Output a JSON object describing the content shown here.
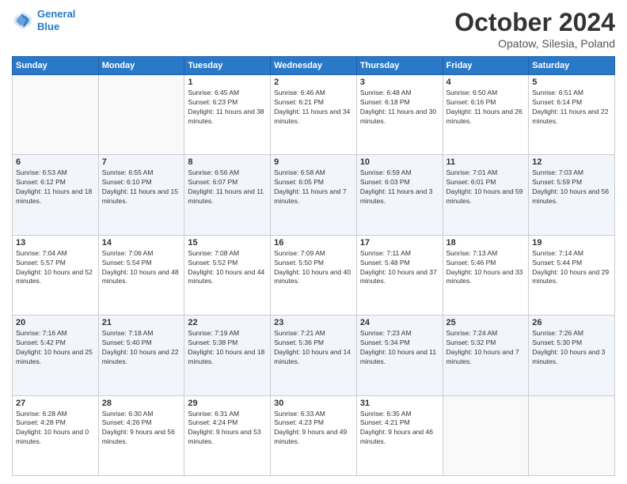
{
  "header": {
    "logo_line1": "General",
    "logo_line2": "Blue",
    "month": "October 2024",
    "location": "Opatow, Silesia, Poland"
  },
  "days_of_week": [
    "Sunday",
    "Monday",
    "Tuesday",
    "Wednesday",
    "Thursday",
    "Friday",
    "Saturday"
  ],
  "weeks": [
    [
      {
        "day": "",
        "sunrise": "",
        "sunset": "",
        "daylight": ""
      },
      {
        "day": "",
        "sunrise": "",
        "sunset": "",
        "daylight": ""
      },
      {
        "day": "1",
        "sunrise": "Sunrise: 6:45 AM",
        "sunset": "Sunset: 6:23 PM",
        "daylight": "Daylight: 11 hours and 38 minutes."
      },
      {
        "day": "2",
        "sunrise": "Sunrise: 6:46 AM",
        "sunset": "Sunset: 6:21 PM",
        "daylight": "Daylight: 11 hours and 34 minutes."
      },
      {
        "day": "3",
        "sunrise": "Sunrise: 6:48 AM",
        "sunset": "Sunset: 6:18 PM",
        "daylight": "Daylight: 11 hours and 30 minutes."
      },
      {
        "day": "4",
        "sunrise": "Sunrise: 6:50 AM",
        "sunset": "Sunset: 6:16 PM",
        "daylight": "Daylight: 11 hours and 26 minutes."
      },
      {
        "day": "5",
        "sunrise": "Sunrise: 6:51 AM",
        "sunset": "Sunset: 6:14 PM",
        "daylight": "Daylight: 11 hours and 22 minutes."
      }
    ],
    [
      {
        "day": "6",
        "sunrise": "Sunrise: 6:53 AM",
        "sunset": "Sunset: 6:12 PM",
        "daylight": "Daylight: 11 hours and 18 minutes."
      },
      {
        "day": "7",
        "sunrise": "Sunrise: 6:55 AM",
        "sunset": "Sunset: 6:10 PM",
        "daylight": "Daylight: 11 hours and 15 minutes."
      },
      {
        "day": "8",
        "sunrise": "Sunrise: 6:56 AM",
        "sunset": "Sunset: 6:07 PM",
        "daylight": "Daylight: 11 hours and 11 minutes."
      },
      {
        "day": "9",
        "sunrise": "Sunrise: 6:58 AM",
        "sunset": "Sunset: 6:05 PM",
        "daylight": "Daylight: 11 hours and 7 minutes."
      },
      {
        "day": "10",
        "sunrise": "Sunrise: 6:59 AM",
        "sunset": "Sunset: 6:03 PM",
        "daylight": "Daylight: 11 hours and 3 minutes."
      },
      {
        "day": "11",
        "sunrise": "Sunrise: 7:01 AM",
        "sunset": "Sunset: 6:01 PM",
        "daylight": "Daylight: 10 hours and 59 minutes."
      },
      {
        "day": "12",
        "sunrise": "Sunrise: 7:03 AM",
        "sunset": "Sunset: 5:59 PM",
        "daylight": "Daylight: 10 hours and 56 minutes."
      }
    ],
    [
      {
        "day": "13",
        "sunrise": "Sunrise: 7:04 AM",
        "sunset": "Sunset: 5:57 PM",
        "daylight": "Daylight: 10 hours and 52 minutes."
      },
      {
        "day": "14",
        "sunrise": "Sunrise: 7:06 AM",
        "sunset": "Sunset: 5:54 PM",
        "daylight": "Daylight: 10 hours and 48 minutes."
      },
      {
        "day": "15",
        "sunrise": "Sunrise: 7:08 AM",
        "sunset": "Sunset: 5:52 PM",
        "daylight": "Daylight: 10 hours and 44 minutes."
      },
      {
        "day": "16",
        "sunrise": "Sunrise: 7:09 AM",
        "sunset": "Sunset: 5:50 PM",
        "daylight": "Daylight: 10 hours and 40 minutes."
      },
      {
        "day": "17",
        "sunrise": "Sunrise: 7:11 AM",
        "sunset": "Sunset: 5:48 PM",
        "daylight": "Daylight: 10 hours and 37 minutes."
      },
      {
        "day": "18",
        "sunrise": "Sunrise: 7:13 AM",
        "sunset": "Sunset: 5:46 PM",
        "daylight": "Daylight: 10 hours and 33 minutes."
      },
      {
        "day": "19",
        "sunrise": "Sunrise: 7:14 AM",
        "sunset": "Sunset: 5:44 PM",
        "daylight": "Daylight: 10 hours and 29 minutes."
      }
    ],
    [
      {
        "day": "20",
        "sunrise": "Sunrise: 7:16 AM",
        "sunset": "Sunset: 5:42 PM",
        "daylight": "Daylight: 10 hours and 25 minutes."
      },
      {
        "day": "21",
        "sunrise": "Sunrise: 7:18 AM",
        "sunset": "Sunset: 5:40 PM",
        "daylight": "Daylight: 10 hours and 22 minutes."
      },
      {
        "day": "22",
        "sunrise": "Sunrise: 7:19 AM",
        "sunset": "Sunset: 5:38 PM",
        "daylight": "Daylight: 10 hours and 18 minutes."
      },
      {
        "day": "23",
        "sunrise": "Sunrise: 7:21 AM",
        "sunset": "Sunset: 5:36 PM",
        "daylight": "Daylight: 10 hours and 14 minutes."
      },
      {
        "day": "24",
        "sunrise": "Sunrise: 7:23 AM",
        "sunset": "Sunset: 5:34 PM",
        "daylight": "Daylight: 10 hours and 11 minutes."
      },
      {
        "day": "25",
        "sunrise": "Sunrise: 7:24 AM",
        "sunset": "Sunset: 5:32 PM",
        "daylight": "Daylight: 10 hours and 7 minutes."
      },
      {
        "day": "26",
        "sunrise": "Sunrise: 7:26 AM",
        "sunset": "Sunset: 5:30 PM",
        "daylight": "Daylight: 10 hours and 3 minutes."
      }
    ],
    [
      {
        "day": "27",
        "sunrise": "Sunrise: 6:28 AM",
        "sunset": "Sunset: 4:28 PM",
        "daylight": "Daylight: 10 hours and 0 minutes."
      },
      {
        "day": "28",
        "sunrise": "Sunrise: 6:30 AM",
        "sunset": "Sunset: 4:26 PM",
        "daylight": "Daylight: 9 hours and 56 minutes."
      },
      {
        "day": "29",
        "sunrise": "Sunrise: 6:31 AM",
        "sunset": "Sunset: 4:24 PM",
        "daylight": "Daylight: 9 hours and 53 minutes."
      },
      {
        "day": "30",
        "sunrise": "Sunrise: 6:33 AM",
        "sunset": "Sunset: 4:23 PM",
        "daylight": "Daylight: 9 hours and 49 minutes."
      },
      {
        "day": "31",
        "sunrise": "Sunrise: 6:35 AM",
        "sunset": "Sunset: 4:21 PM",
        "daylight": "Daylight: 9 hours and 46 minutes."
      },
      {
        "day": "",
        "sunrise": "",
        "sunset": "",
        "daylight": ""
      },
      {
        "day": "",
        "sunrise": "",
        "sunset": "",
        "daylight": ""
      }
    ]
  ]
}
